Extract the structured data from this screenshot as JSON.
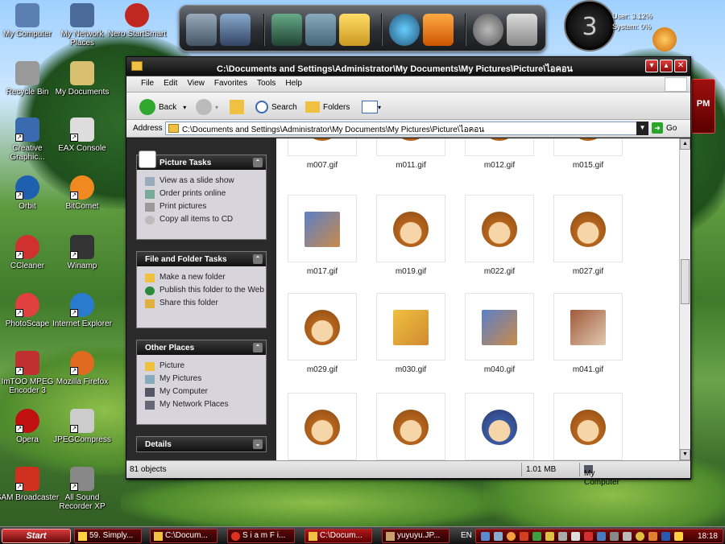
{
  "desktop": {
    "icons": [
      {
        "label": "My Computer"
      },
      {
        "label": "My Network Places"
      },
      {
        "label": "Nero StartSmart"
      },
      {
        "label": "Recycle Bin"
      },
      {
        "label": "My Documents"
      },
      {
        "label": "Creative Graphic..."
      },
      {
        "label": "EAX Console"
      },
      {
        "label": "Orbit"
      },
      {
        "label": "BitComet"
      },
      {
        "label": "CCleaner"
      },
      {
        "label": "Winamp"
      },
      {
        "label": "PhotoScape"
      },
      {
        "label": "Internet Explorer"
      },
      {
        "label": "ImTOO MPEG Encoder 3"
      },
      {
        "label": "Mozilla Firefox"
      },
      {
        "label": "Opera"
      },
      {
        "label": "JPEGCompress"
      },
      {
        "label": "SAM Broadcaster"
      },
      {
        "label": "All Sound Recorder XP"
      }
    ],
    "clock_widget": "3",
    "sysmon": {
      "user": "User: 3.12%",
      "system": "System: 0%"
    },
    "side_panel": "PM"
  },
  "window": {
    "title": "C:\\Documents and Settings\\Administrator\\My Documents\\My Pictures\\Picture\\ไอคอน",
    "menu": [
      "File",
      "Edit",
      "View",
      "Favorites",
      "Tools",
      "Help"
    ],
    "toolbar": {
      "back": "Back",
      "search": "Search",
      "folders": "Folders"
    },
    "address": {
      "label": "Address",
      "value": "C:\\Documents and Settings\\Administrator\\My Documents\\My Pictures\\Picture\\ไอคอน",
      "go": "Go"
    },
    "tasks": {
      "picture_tasks": {
        "title": "Picture Tasks",
        "items": [
          "View as a slide show",
          "Order prints online",
          "Print pictures",
          "Copy all items to CD"
        ]
      },
      "file_folder_tasks": {
        "title": "File and Folder Tasks",
        "items": [
          "Make a new folder",
          "Publish this folder to the Web",
          "Share this folder"
        ]
      },
      "other_places": {
        "title": "Other Places",
        "items": [
          "Picture",
          "My Pictures",
          "My Computer",
          "My Network Places"
        ]
      },
      "details": {
        "title": "Details"
      }
    },
    "files": [
      "m007.gif",
      "m011.gif",
      "m012.gif",
      "m015.gif",
      "m017.gif",
      "m019.gif",
      "m022.gif",
      "m027.gif",
      "m029.gif",
      "m030.gif",
      "m040.gif",
      "m041.gif"
    ],
    "status": {
      "objects": "81 objects",
      "size": "1.01 MB",
      "location": "My Computer"
    }
  },
  "taskbar": {
    "start": "Start",
    "tasks": [
      "59. Simply...",
      "C:\\Docum...",
      "S i a m F i...",
      "C:\\Docum...",
      "yuyuyu.JP..."
    ],
    "lang": "EN",
    "clock": "18:18"
  }
}
